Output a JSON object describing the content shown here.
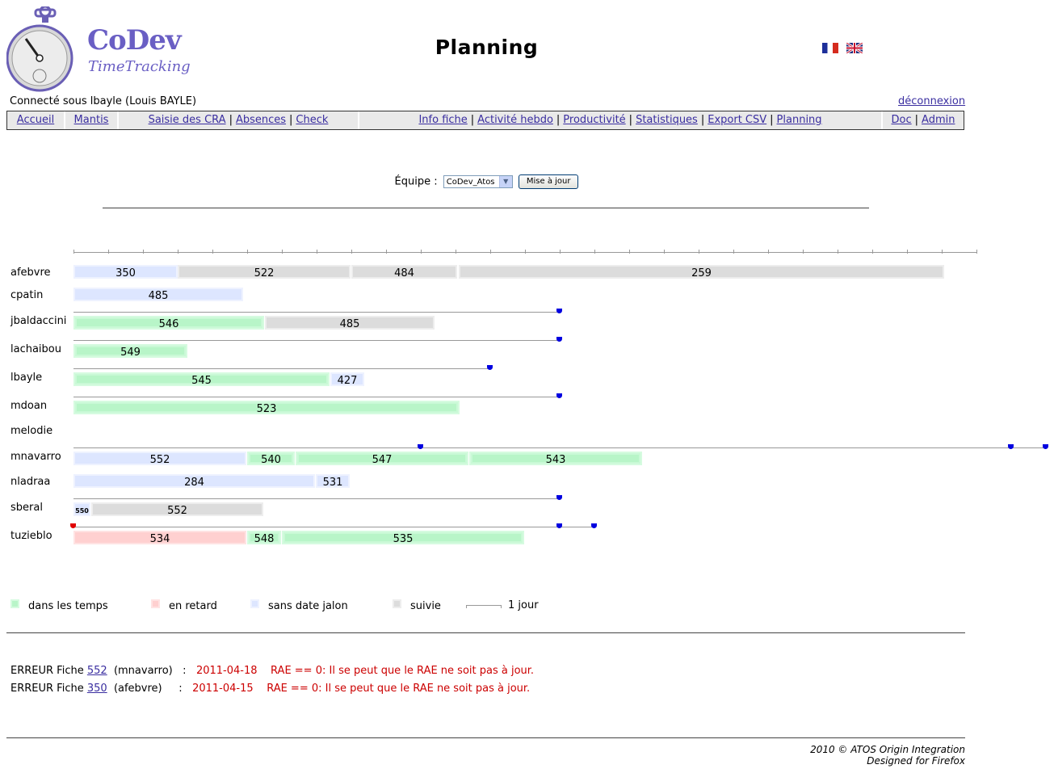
{
  "app": {
    "logo_title": "CoDev",
    "logo_subtitle": "TimeTracking",
    "page_title": "Planning"
  },
  "header": {
    "connected": "Connecté sous lbayle (Louis BAYLE)",
    "logout": "déconnexion",
    "flags": [
      "fr-flag-icon",
      "uk-flag-icon"
    ]
  },
  "menu": {
    "home": "Accueil",
    "mantis": "Mantis",
    "group2": [
      "Saisie des CRA",
      "Absences",
      "Check"
    ],
    "group3": [
      "Info fiche",
      "Activité hebdo",
      "Productivité",
      "Statistiques",
      "Export CSV",
      "Planning"
    ],
    "group4": [
      "Doc",
      "Admin"
    ]
  },
  "team": {
    "label": "Équipe :",
    "selected": "CoDev_Atos",
    "button": "Mise à jour"
  },
  "gantt": {
    "colors": {
      "dans_les_temps": "#b8f5c8",
      "en_retard": "#ffd0d0",
      "sans_date_jalon": "#dde6ff",
      "suivie": "#dcdcdc"
    },
    "users": [
      {
        "name": "afebvre",
        "tasks": [
          {
            "id": "350",
            "status": "blue"
          },
          {
            "id": "522",
            "status": "grey"
          },
          {
            "id": "484",
            "status": "grey"
          },
          {
            "id": "259",
            "status": "grey"
          }
        ]
      },
      {
        "name": "cpatin",
        "tasks": [
          {
            "id": "485",
            "status": "blue"
          }
        ]
      },
      {
        "name": "jbaldaccini",
        "tasks": [
          {
            "id": "546",
            "status": "green"
          },
          {
            "id": "485",
            "status": "grey"
          }
        ]
      },
      {
        "name": "lachaibou",
        "tasks": [
          {
            "id": "549",
            "status": "green"
          }
        ]
      },
      {
        "name": "lbayle",
        "tasks": [
          {
            "id": "545",
            "status": "green"
          },
          {
            "id": "427",
            "status": "blue"
          }
        ]
      },
      {
        "name": "mdoan",
        "tasks": [
          {
            "id": "523",
            "status": "green"
          }
        ]
      },
      {
        "name": "melodie",
        "tasks": []
      },
      {
        "name": "mnavarro",
        "tasks": [
          {
            "id": "552",
            "status": "blue"
          },
          {
            "id": "540",
            "status": "green"
          },
          {
            "id": "547",
            "status": "green"
          },
          {
            "id": "543",
            "status": "green"
          }
        ]
      },
      {
        "name": "nladraa",
        "tasks": [
          {
            "id": "284",
            "status": "blue"
          },
          {
            "id": "531",
            "status": "blue"
          }
        ]
      },
      {
        "name": "sberal",
        "tasks": [
          {
            "id": "550",
            "status": "blue"
          },
          {
            "id": "552",
            "status": "grey"
          }
        ]
      },
      {
        "name": "tuzieblo",
        "tasks": [
          {
            "id": "534",
            "status": "red"
          },
          {
            "id": "548",
            "status": "green"
          },
          {
            "id": "535",
            "status": "green"
          }
        ]
      }
    ]
  },
  "legend": {
    "on_time": "dans les temps",
    "late": "en retard",
    "no_deadline": "sans date jalon",
    "followed": "suivie",
    "one_day": "1 jour"
  },
  "errors": [
    {
      "prefix": "ERREUR Fiche",
      "fiche": "552",
      "user": "(mnavarro)",
      "sep": ":",
      "date": "2011-04-18",
      "msg": "RAE == 0: Il se peut que le RAE ne soit pas à jour."
    },
    {
      "prefix": "ERREUR Fiche",
      "fiche": "350",
      "user": "(afebvre)",
      "sep": ":",
      "date": "2011-04-15",
      "msg": "RAE == 0: Il se peut que le RAE ne soit pas à jour."
    }
  ],
  "footer": {
    "line1": "2010 © ATOS Origin Integration",
    "line2": "Designed for Firefox"
  }
}
